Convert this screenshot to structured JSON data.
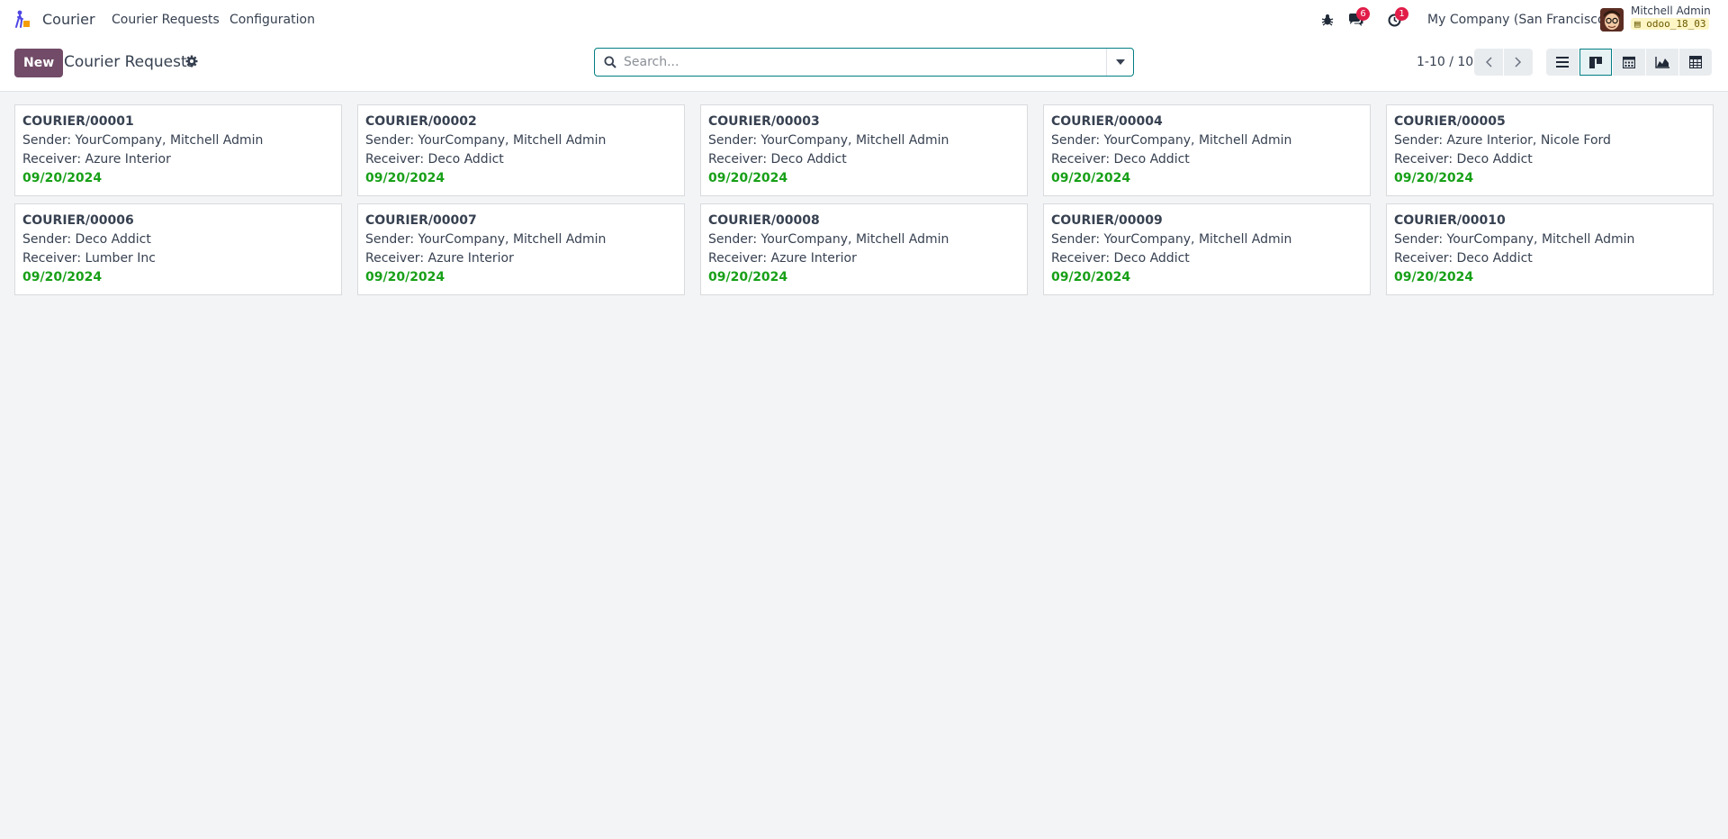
{
  "navbar": {
    "app_name": "Courier",
    "menus": [
      "Courier Requests",
      "Configuration"
    ],
    "messages_count": "6",
    "activities_count": "1",
    "company": "My Company (San Francisco)",
    "user_name": "Mitchell Admin",
    "db_name": "odoo_18_03"
  },
  "control": {
    "new_label": "New",
    "title": "Courier Requests",
    "search_placeholder": "Search...",
    "pager": "1-10 / 10"
  },
  "colors": {
    "brand": "#714b67",
    "accent": "#017e84",
    "date_green": "#18a018",
    "badge_red": "#e11d48"
  },
  "views": [
    "list-view-icon",
    "kanban-view-icon",
    "calendar-view-icon",
    "graph-view-icon",
    "pivot-view-icon"
  ],
  "active_view": "kanban-view-icon",
  "records": [
    {
      "ref": "COURIER/00001",
      "sender": "Sender: YourCompany, Mitchell Admin",
      "receiver": "Receiver: Azure Interior",
      "date": "09/20/2024"
    },
    {
      "ref": "COURIER/00002",
      "sender": "Sender: YourCompany, Mitchell Admin",
      "receiver": "Receiver: Deco Addict",
      "date": "09/20/2024"
    },
    {
      "ref": "COURIER/00003",
      "sender": "Sender: YourCompany, Mitchell Admin",
      "receiver": "Receiver: Deco Addict",
      "date": "09/20/2024"
    },
    {
      "ref": "COURIER/00004",
      "sender": "Sender: YourCompany, Mitchell Admin",
      "receiver": "Receiver: Deco Addict",
      "date": "09/20/2024"
    },
    {
      "ref": "COURIER/00005",
      "sender": "Sender: Azure Interior, Nicole Ford",
      "receiver": "Receiver: Deco Addict",
      "date": "09/20/2024"
    },
    {
      "ref": "COURIER/00006",
      "sender": "Sender: Deco Addict",
      "receiver": "Receiver: Lumber Inc",
      "date": "09/20/2024"
    },
    {
      "ref": "COURIER/00007",
      "sender": "Sender: YourCompany, Mitchell Admin",
      "receiver": "Receiver: Azure Interior",
      "date": "09/20/2024"
    },
    {
      "ref": "COURIER/00008",
      "sender": "Sender: YourCompany, Mitchell Admin",
      "receiver": "Receiver: Azure Interior",
      "date": "09/20/2024"
    },
    {
      "ref": "COURIER/00009",
      "sender": "Sender: YourCompany, Mitchell Admin",
      "receiver": "Receiver: Deco Addict",
      "date": "09/20/2024"
    },
    {
      "ref": "COURIER/00010",
      "sender": "Sender: YourCompany, Mitchell Admin",
      "receiver": "Receiver: Deco Addict",
      "date": "09/20/2024"
    }
  ]
}
